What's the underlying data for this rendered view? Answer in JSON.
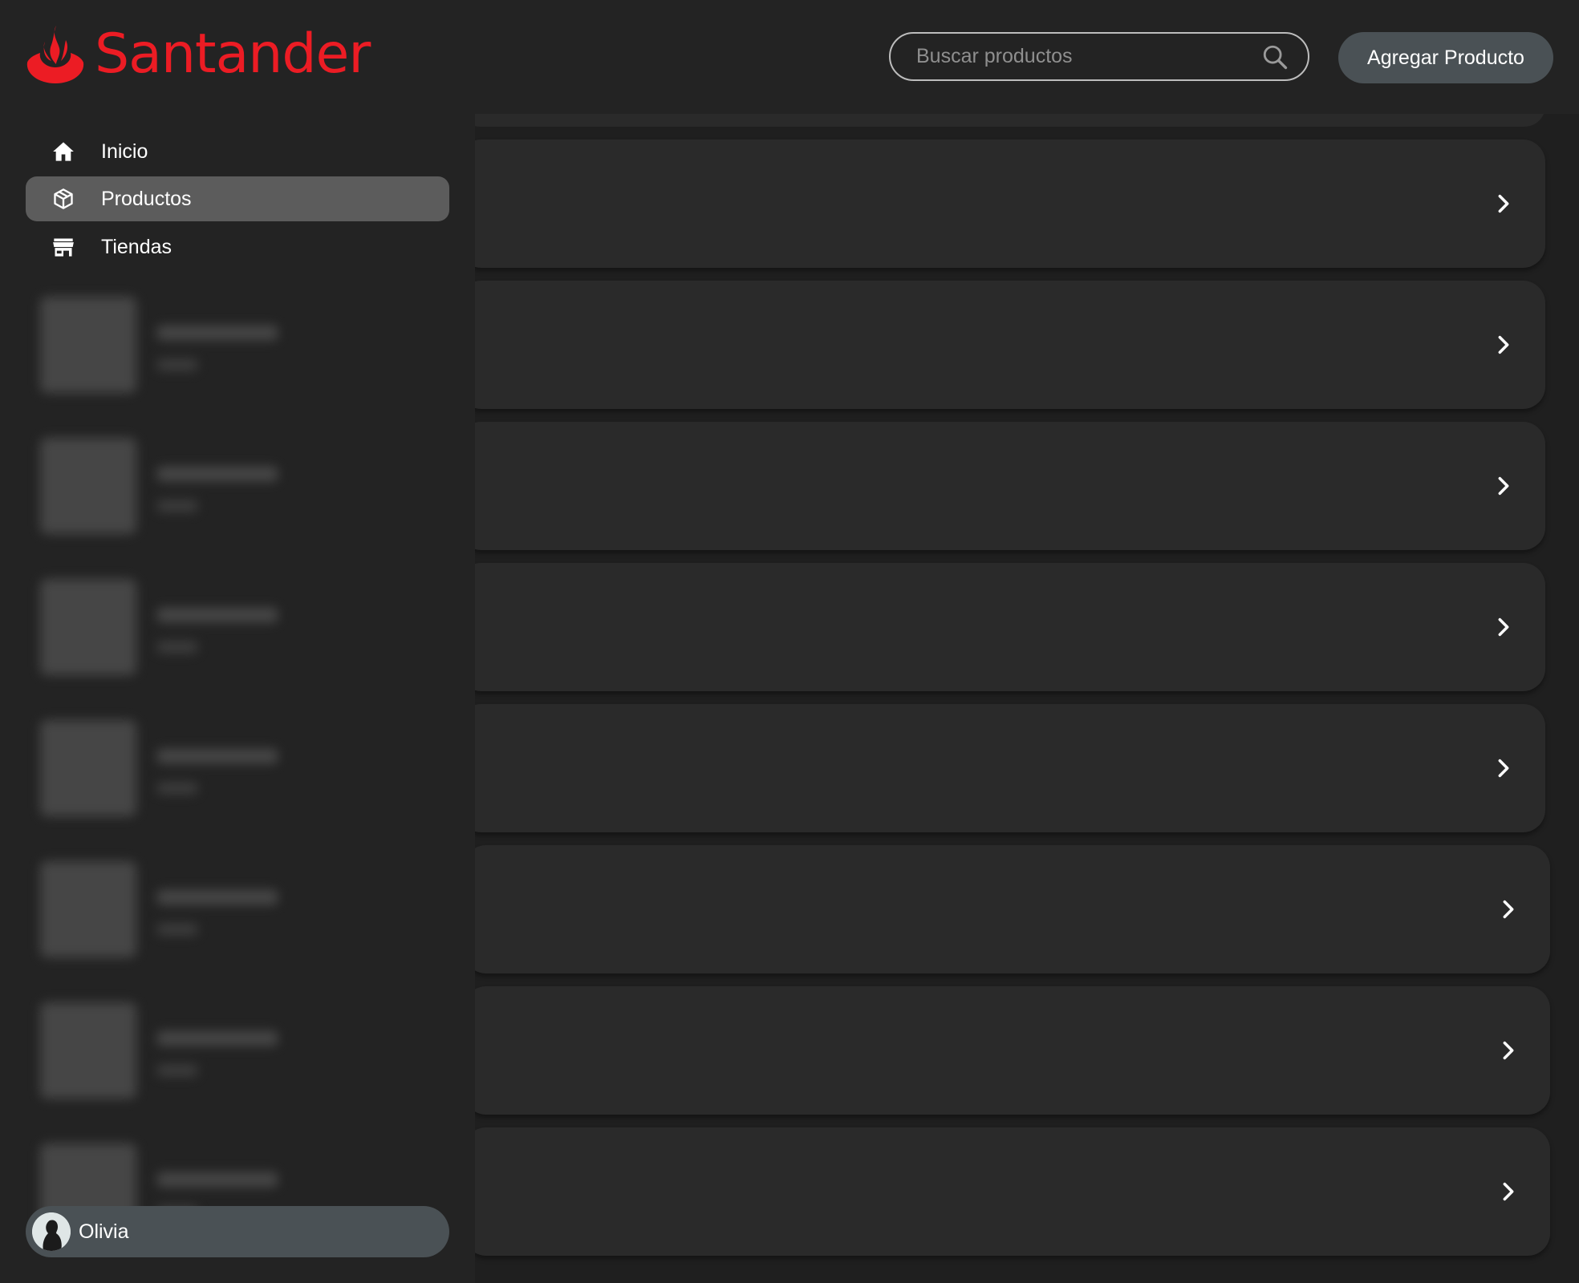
{
  "brand": {
    "name": "Santander",
    "color": "#ec1c24",
    "icon": "flame-logo-icon"
  },
  "sidebar": {
    "items": [
      {
        "label": "Inicio",
        "icon": "home-icon",
        "active": false
      },
      {
        "label": "Productos",
        "icon": "box-icon",
        "active": true
      },
      {
        "label": "Tiendas",
        "icon": "store-icon",
        "active": false
      }
    ],
    "user": {
      "name": "Olivia",
      "avatar_icon": "avatar"
    }
  },
  "header": {
    "search": {
      "placeholder": "Buscar productos",
      "value": "",
      "icon": "search-icon"
    },
    "add_button_label": "Agregar Producto"
  },
  "products": {
    "row_count": 8,
    "row_icon": "chevron-right-icon"
  },
  "colors": {
    "background": "#1f1f1f",
    "sidebar": "#232323",
    "card": "#2a2a2a",
    "active_nav": "#5c5c5c",
    "pill": "#4a5155"
  }
}
